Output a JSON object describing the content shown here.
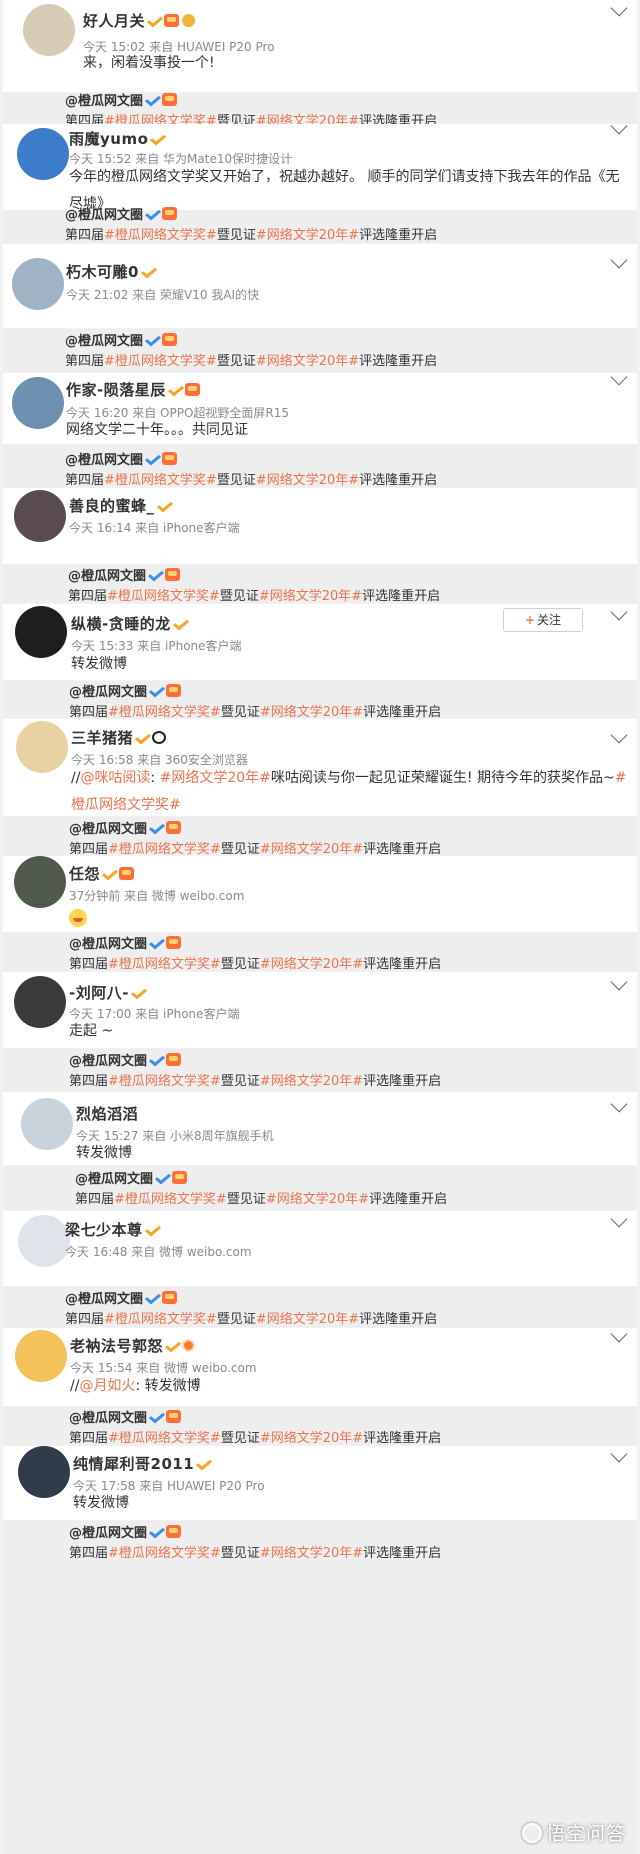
{
  "posts": [
    {
      "name": "好人月关",
      "meta": "今天 15:02 来自 HUAWEI P20 Pro",
      "text": "来，闲着没事投一个!",
      "avatar_color": "#d7cbb5"
    },
    {
      "name": "雨魔yumo",
      "meta": "今天 15:52 来自 华为Mate10保时捷设计",
      "text": "今年的橙瓜网络文学奖又开始了，祝越办越好。 顺手的同学们请支持下我去年的作品《无尽墟》",
      "avatar_color": "#3d7cc9"
    },
    {
      "name": "朽木可雕0",
      "meta": "今天 21:02 来自 荣耀V10 我AI的快",
      "text": "",
      "avatar_color": "#9fb3c4"
    },
    {
      "name": "作家-陨落星辰",
      "meta": "今天 16:20 来自 OPPO超视野全面屏R15",
      "text": "网络文学二十年。。。共同见证",
      "avatar_color": "#6d8fb0"
    },
    {
      "name": "善良的蜜蜂_",
      "meta": "今天 16:14 来自 iPhone客户端",
      "text": "",
      "avatar_color": "#5a4a52"
    },
    {
      "name": "纵横-贪睡的龙",
      "meta": "今天 15:33 来自 iPhone客户端",
      "text": "转发微博",
      "avatar_color": "#1e1e1e",
      "follow_label": "关注"
    },
    {
      "name": "三羊猪猪",
      "meta": "今天 16:58 来自 360安全浏览器",
      "mention": "@咪咕阅读",
      "text_a": ": ",
      "tag": "#网络文学20年#",
      "text_b": "咪咕阅读与你一起见证荣耀诞生! 期待今年的获奖作品~",
      "tag2": "#橙瓜网络文学奖#",
      "avatar_color": "#e8d2a4"
    },
    {
      "name": "任怨",
      "meta": "37分钟前 来自 微博 weibo.com",
      "text": "",
      "avatar_color": "#4f5a4d"
    },
    {
      "name": "-刘阿八-",
      "meta": "今天 17:00 来自 iPhone客户端",
      "text": "走起 ~",
      "avatar_color": "#3b3b3b"
    },
    {
      "name": "烈焰滔滔",
      "meta": "今天 15:27 来自 小米8周年旗舰手机",
      "text": "转发微博",
      "avatar_color": "#c9d3dc"
    },
    {
      "name": "梁七少本尊",
      "meta": "今天 16:48 来自 微博 weibo.com",
      "text": "",
      "avatar_color": "#dfe3ea"
    },
    {
      "name": "老衲法号郭怒",
      "meta": "今天 15:54 来自 微博 weibo.com",
      "mention": "@月如火",
      "text_a": ": 转发微博",
      "avatar_color": "#f3c25a"
    },
    {
      "name": "纯情犀利哥2011",
      "meta": "今天 17:58 来自 HUAWEI P20 Pro",
      "text": "转发微博",
      "avatar_color": "#2f3d4a"
    }
  ],
  "repost": {
    "author": "@橙瓜网文圈",
    "prefix": "第四届",
    "tag1": "#橙瓜网络文学奖#",
    "mid": "暨见证",
    "tag2": "#网络文学20年#",
    "suffix": "评选隆重开启"
  },
  "watermark": "悟空问答"
}
